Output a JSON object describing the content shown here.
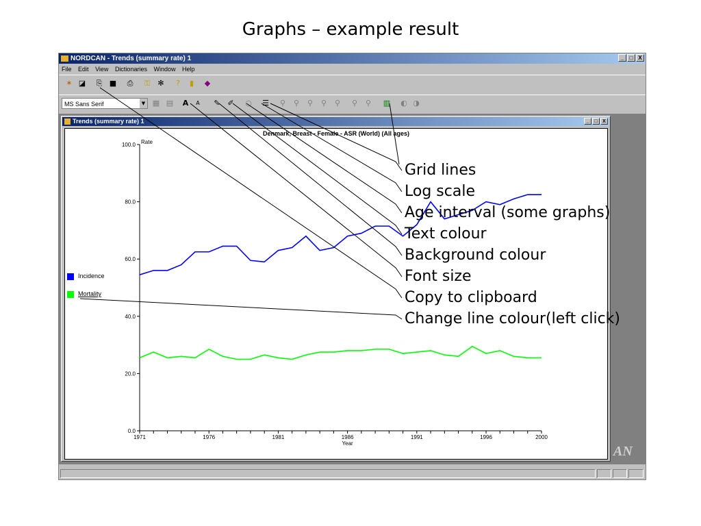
{
  "slide_title": "Graphs – example result",
  "app": {
    "title": "NORDCAN - Trends (summary rate) 1",
    "window_buttons": [
      "_",
      "□",
      "X"
    ],
    "menu": [
      "File",
      "Edit",
      "View",
      "Dictionaries",
      "Window",
      "Help"
    ],
    "font_selector": "MS Sans Serif",
    "status_bar": "",
    "watermark": "AN"
  },
  "child_window": {
    "title": "Trends (summary rate) 1",
    "buttons": [
      "_",
      "□",
      "X"
    ]
  },
  "chart_data": {
    "type": "line",
    "title": "Denmark, Breast - Female - ASR (World) (All ages)",
    "xlabel": "Year",
    "ylabel": "Rate",
    "xlim": [
      1971,
      2000
    ],
    "ylim": [
      0,
      100
    ],
    "xticks": [
      "1971",
      "1976",
      "1981",
      "1986",
      "1991",
      "1996",
      "2000"
    ],
    "yticks": [
      "0.0",
      "20.0",
      "40.0",
      "60.0",
      "80.0",
      "100.0"
    ],
    "legend_position": "left",
    "x": [
      1971,
      1972,
      1973,
      1974,
      1975,
      1976,
      1977,
      1978,
      1979,
      1980,
      1981,
      1982,
      1983,
      1984,
      1985,
      1986,
      1987,
      1988,
      1989,
      1990,
      1991,
      1992,
      1993,
      1994,
      1995,
      1996,
      1997,
      1998,
      1999,
      2000
    ],
    "series": [
      {
        "name": "Incidence",
        "color": "#0000ff",
        "values": [
          54.5,
          56,
          56,
          58,
          62.5,
          62.5,
          64.5,
          64.5,
          59.5,
          59,
          63,
          64,
          68,
          63,
          64,
          68,
          69,
          71.5,
          71.5,
          68,
          72,
          80,
          74,
          75.5,
          77,
          80,
          79,
          81,
          82.5,
          82.5
        ]
      },
      {
        "name": "Mortality",
        "color": "#00ff00",
        "values": [
          25.5,
          27.5,
          25.5,
          26,
          25.5,
          28.5,
          26,
          25,
          25,
          26.5,
          25.5,
          25,
          26.5,
          27.5,
          27.5,
          28,
          28,
          28.5,
          28.5,
          27,
          27.5,
          28,
          26.5,
          26,
          29.5,
          27,
          28,
          26,
          25.5,
          25.5
        ]
      }
    ]
  },
  "callouts": [
    "Grid lines",
    "Log scale",
    "Age interval (some graphs)",
    "Text colour",
    "Background colour",
    "Font size",
    "Copy to clipboard",
    "Change line colour(left click)"
  ]
}
